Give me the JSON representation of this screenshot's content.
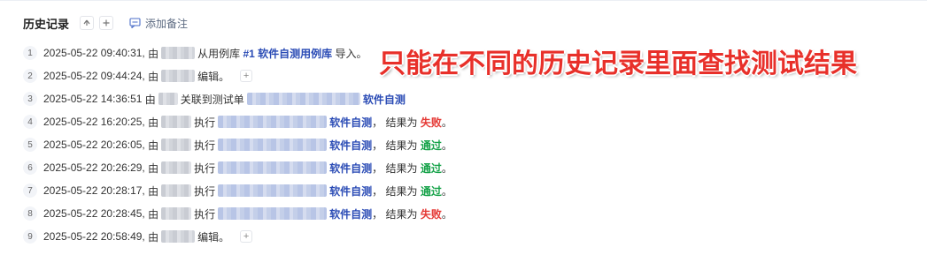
{
  "header": {
    "title": "历史记录",
    "up_icon": "arrow-up-icon",
    "add_icon": "plus-icon",
    "add_note_label": "添加备注"
  },
  "annotation": "只能在不同的历史记录里面查找测试结果",
  "colors": {
    "link": "#2a4bb5",
    "fail": "#e53935",
    "pass": "#17a34a",
    "annotation": "#e8302a"
  },
  "records": [
    {
      "index": "1",
      "time": "2025-05-22 09:40:31,",
      "by": "由",
      "action": "从用例库",
      "link": "#1 软件自测用例库",
      "tail": "导入。"
    },
    {
      "index": "2",
      "time": "2025-05-22 09:44:24,",
      "by": "由",
      "action": "编辑。"
    },
    {
      "index": "3",
      "time": "2025-05-22 14:36:51",
      "by": "由",
      "action": "关联到测试单",
      "link": "软件自测"
    },
    {
      "index": "4",
      "time": "2025-05-22 16:20:25,",
      "by": "由",
      "action": "执行",
      "link": "软件自测",
      "result_label": "，  结果为",
      "result": "失败",
      "dot": "。"
    },
    {
      "index": "5",
      "time": "2025-05-22 20:26:05,",
      "by": "由",
      "action": "执行",
      "link": "软件自测",
      "result_label": "，  结果为",
      "result": "通过",
      "dot": "。"
    },
    {
      "index": "6",
      "time": "2025-05-22 20:26:29,",
      "by": "由",
      "action": "执行",
      "link": "软件自测",
      "result_label": "，  结果为",
      "result": "通过",
      "dot": "。"
    },
    {
      "index": "7",
      "time": "2025-05-22 20:28:17,",
      "by": "由",
      "action": "执行",
      "link": "软件自测",
      "result_label": "，  结果为",
      "result": "通过",
      "dot": "。"
    },
    {
      "index": "8",
      "time": "2025-05-22 20:28:45,",
      "by": "由",
      "action": "执行",
      "link": "软件自测",
      "result_label": "，  结果为",
      "result": "失败",
      "dot": "。"
    },
    {
      "index": "9",
      "time": "2025-05-22 20:58:49,",
      "by": "由",
      "action": "编辑。"
    }
  ]
}
